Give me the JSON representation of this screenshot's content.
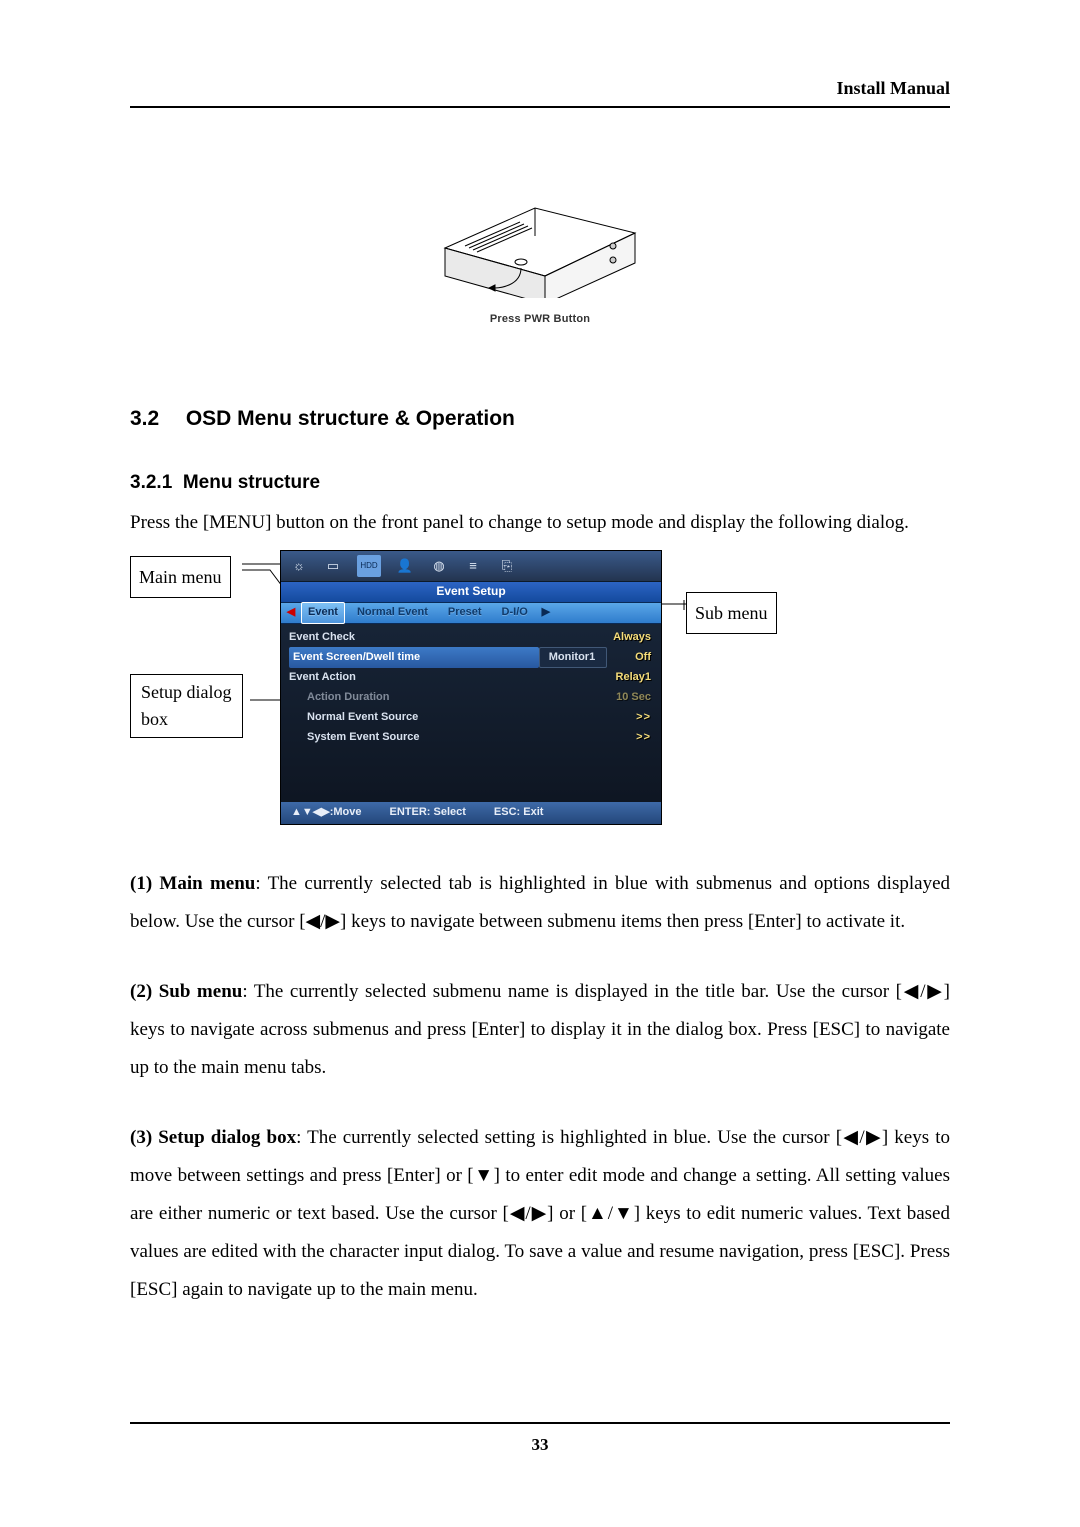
{
  "header": {
    "title": "Install Manual"
  },
  "device": {
    "caption": "Press PWR Button"
  },
  "section": {
    "number": "3.2",
    "title": "OSD Menu structure & Operation",
    "sub_number": "3.2.1",
    "sub_title": "Menu structure",
    "intro": "Press the [MENU] button on the front panel to change to setup mode and display the following dialog."
  },
  "callouts": {
    "main": "Main menu",
    "sub": "Sub menu",
    "setup1": "Setup dialog",
    "setup2": "box"
  },
  "osd": {
    "title": "Event Setup",
    "submenu": {
      "left_arrow": "◀",
      "right_arrow": "▶",
      "tabs": [
        "Event",
        "Normal Event",
        "Preset",
        "D-I/O"
      ]
    },
    "rows": [
      {
        "label": "Event Check",
        "value": "Always",
        "selected": false
      },
      {
        "label": "Event Screen/Dwell time",
        "value_box": "Monitor1",
        "value": "Off",
        "selected": true
      },
      {
        "label": "Event Action",
        "value": "Relay1",
        "selected": false
      },
      {
        "label": "Action Duration",
        "value": "10 Sec",
        "selected": false,
        "dim": true
      },
      {
        "label": "Normal Event Source",
        "value": ">>",
        "indent": true
      },
      {
        "label": "System Event Source",
        "value": ">>",
        "indent": true
      }
    ],
    "footer": {
      "move": "▲▼◀▶:Move",
      "select": "ENTER: Select",
      "exit": "ESC: Exit"
    }
  },
  "paragraphs": {
    "p1_lead": "(1) Main menu",
    "p1_body": ": The currently selected tab is highlighted in blue with submenus and options displayed below. Use the cursor [◀/▶] keys to navigate between submenu items then press [Enter] to activate it.",
    "p2_lead": "(2) Sub menu",
    "p2_body": ": The currently selected submenu name is displayed in the title bar. Use the cursor [◀/▶] keys to navigate across submenus and press [Enter] to display it in the dialog box. Press [ESC] to navigate up to the main menu tabs.",
    "p3_lead": "(3) Setup dialog box",
    "p3_body": ": The currently selected setting is highlighted in blue. Use the cursor [◀/▶] keys to move between settings and press [Enter] or [▼] to enter edit mode and change a setting. All setting values are either numeric or text based. Use the cursor [◀/▶] or [▲/▼] keys to edit numeric values. Text based values are edited with the character input dialog. To save a value and resume navigation, press [ESC]. Press [ESC] again to navigate up to the main menu."
  },
  "footer": {
    "page": "33"
  },
  "icons": {
    "sun": "☼",
    "monitor": "▭",
    "hdd": "HDD",
    "person": "👤",
    "disk": "◍",
    "net": "≡",
    "exit": "⎘"
  }
}
